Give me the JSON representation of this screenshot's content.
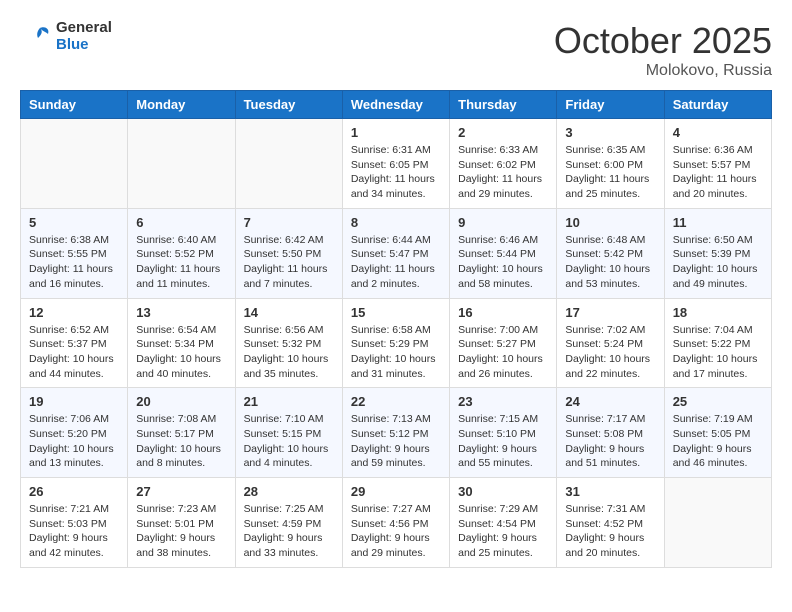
{
  "header": {
    "logo_line1": "General",
    "logo_line2": "Blue",
    "month": "October 2025",
    "location": "Molokovo, Russia"
  },
  "weekdays": [
    "Sunday",
    "Monday",
    "Tuesday",
    "Wednesday",
    "Thursday",
    "Friday",
    "Saturday"
  ],
  "weeks": [
    [
      {
        "day": "",
        "info": ""
      },
      {
        "day": "",
        "info": ""
      },
      {
        "day": "",
        "info": ""
      },
      {
        "day": "1",
        "info": "Sunrise: 6:31 AM\nSunset: 6:05 PM\nDaylight: 11 hours\nand 34 minutes."
      },
      {
        "day": "2",
        "info": "Sunrise: 6:33 AM\nSunset: 6:02 PM\nDaylight: 11 hours\nand 29 minutes."
      },
      {
        "day": "3",
        "info": "Sunrise: 6:35 AM\nSunset: 6:00 PM\nDaylight: 11 hours\nand 25 minutes."
      },
      {
        "day": "4",
        "info": "Sunrise: 6:36 AM\nSunset: 5:57 PM\nDaylight: 11 hours\nand 20 minutes."
      }
    ],
    [
      {
        "day": "5",
        "info": "Sunrise: 6:38 AM\nSunset: 5:55 PM\nDaylight: 11 hours\nand 16 minutes."
      },
      {
        "day": "6",
        "info": "Sunrise: 6:40 AM\nSunset: 5:52 PM\nDaylight: 11 hours\nand 11 minutes."
      },
      {
        "day": "7",
        "info": "Sunrise: 6:42 AM\nSunset: 5:50 PM\nDaylight: 11 hours\nand 7 minutes."
      },
      {
        "day": "8",
        "info": "Sunrise: 6:44 AM\nSunset: 5:47 PM\nDaylight: 11 hours\nand 2 minutes."
      },
      {
        "day": "9",
        "info": "Sunrise: 6:46 AM\nSunset: 5:44 PM\nDaylight: 10 hours\nand 58 minutes."
      },
      {
        "day": "10",
        "info": "Sunrise: 6:48 AM\nSunset: 5:42 PM\nDaylight: 10 hours\nand 53 minutes."
      },
      {
        "day": "11",
        "info": "Sunrise: 6:50 AM\nSunset: 5:39 PM\nDaylight: 10 hours\nand 49 minutes."
      }
    ],
    [
      {
        "day": "12",
        "info": "Sunrise: 6:52 AM\nSunset: 5:37 PM\nDaylight: 10 hours\nand 44 minutes."
      },
      {
        "day": "13",
        "info": "Sunrise: 6:54 AM\nSunset: 5:34 PM\nDaylight: 10 hours\nand 40 minutes."
      },
      {
        "day": "14",
        "info": "Sunrise: 6:56 AM\nSunset: 5:32 PM\nDaylight: 10 hours\nand 35 minutes."
      },
      {
        "day": "15",
        "info": "Sunrise: 6:58 AM\nSunset: 5:29 PM\nDaylight: 10 hours\nand 31 minutes."
      },
      {
        "day": "16",
        "info": "Sunrise: 7:00 AM\nSunset: 5:27 PM\nDaylight: 10 hours\nand 26 minutes."
      },
      {
        "day": "17",
        "info": "Sunrise: 7:02 AM\nSunset: 5:24 PM\nDaylight: 10 hours\nand 22 minutes."
      },
      {
        "day": "18",
        "info": "Sunrise: 7:04 AM\nSunset: 5:22 PM\nDaylight: 10 hours\nand 17 minutes."
      }
    ],
    [
      {
        "day": "19",
        "info": "Sunrise: 7:06 AM\nSunset: 5:20 PM\nDaylight: 10 hours\nand 13 minutes."
      },
      {
        "day": "20",
        "info": "Sunrise: 7:08 AM\nSunset: 5:17 PM\nDaylight: 10 hours\nand 8 minutes."
      },
      {
        "day": "21",
        "info": "Sunrise: 7:10 AM\nSunset: 5:15 PM\nDaylight: 10 hours\nand 4 minutes."
      },
      {
        "day": "22",
        "info": "Sunrise: 7:13 AM\nSunset: 5:12 PM\nDaylight: 9 hours\nand 59 minutes."
      },
      {
        "day": "23",
        "info": "Sunrise: 7:15 AM\nSunset: 5:10 PM\nDaylight: 9 hours\nand 55 minutes."
      },
      {
        "day": "24",
        "info": "Sunrise: 7:17 AM\nSunset: 5:08 PM\nDaylight: 9 hours\nand 51 minutes."
      },
      {
        "day": "25",
        "info": "Sunrise: 7:19 AM\nSunset: 5:05 PM\nDaylight: 9 hours\nand 46 minutes."
      }
    ],
    [
      {
        "day": "26",
        "info": "Sunrise: 7:21 AM\nSunset: 5:03 PM\nDaylight: 9 hours\nand 42 minutes."
      },
      {
        "day": "27",
        "info": "Sunrise: 7:23 AM\nSunset: 5:01 PM\nDaylight: 9 hours\nand 38 minutes."
      },
      {
        "day": "28",
        "info": "Sunrise: 7:25 AM\nSunset: 4:59 PM\nDaylight: 9 hours\nand 33 minutes."
      },
      {
        "day": "29",
        "info": "Sunrise: 7:27 AM\nSunset: 4:56 PM\nDaylight: 9 hours\nand 29 minutes."
      },
      {
        "day": "30",
        "info": "Sunrise: 7:29 AM\nSunset: 4:54 PM\nDaylight: 9 hours\nand 25 minutes."
      },
      {
        "day": "31",
        "info": "Sunrise: 7:31 AM\nSunset: 4:52 PM\nDaylight: 9 hours\nand 20 minutes."
      },
      {
        "day": "",
        "info": ""
      }
    ]
  ]
}
